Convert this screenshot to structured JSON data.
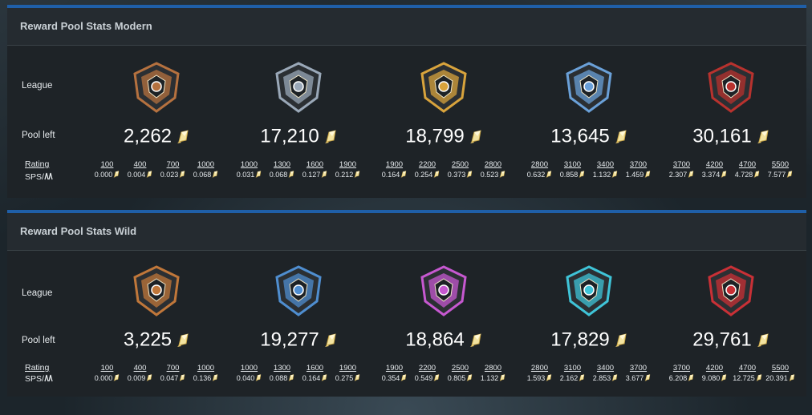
{
  "panels": [
    {
      "title": "Reward Pool Stats Modern",
      "labels": {
        "league": "League",
        "pool": "Pool left",
        "rating": "Rating",
        "sps": "SPS/"
      },
      "tiers": [
        {
          "pool": "2,262",
          "badge": "bronze-league-icon",
          "color": "#b5713f",
          "ratings": [
            "100",
            "400",
            "700",
            "1000"
          ],
          "sps": [
            "0.000",
            "0.004",
            "0.023",
            "0.068"
          ]
        },
        {
          "pool": "17,210",
          "badge": "silver-league-icon",
          "color": "#9aa8b8",
          "ratings": [
            "1000",
            "1300",
            "1600",
            "1900"
          ],
          "sps": [
            "0.031",
            "0.068",
            "0.127",
            "0.212"
          ]
        },
        {
          "pool": "18,799",
          "badge": "gold-league-icon",
          "color": "#d8a33c",
          "ratings": [
            "1900",
            "2200",
            "2500",
            "2800"
          ],
          "sps": [
            "0.164",
            "0.254",
            "0.373",
            "0.523"
          ]
        },
        {
          "pool": "13,645",
          "badge": "diamond-league-icon",
          "color": "#6aa0d8",
          "ratings": [
            "2800",
            "3100",
            "3400",
            "3700"
          ],
          "sps": [
            "0.632",
            "0.858",
            "1.132",
            "1.459"
          ]
        },
        {
          "pool": "30,161",
          "badge": "champion-league-icon",
          "color": "#b8322e",
          "ratings": [
            "3700",
            "4200",
            "4700",
            "5500"
          ],
          "sps": [
            "2.307",
            "3.374",
            "4.728",
            "7.577"
          ]
        }
      ]
    },
    {
      "title": "Reward Pool Stats Wild",
      "labels": {
        "league": "League",
        "pool": "Pool left",
        "rating": "Rating",
        "sps": "SPS/"
      },
      "tiers": [
        {
          "pool": "3,225",
          "badge": "bronze-league-icon",
          "color": "#c0773a",
          "ratings": [
            "100",
            "400",
            "700",
            "1000"
          ],
          "sps": [
            "0.000",
            "0.009",
            "0.047",
            "0.136"
          ]
        },
        {
          "pool": "19,277",
          "badge": "silver-league-icon",
          "color": "#4f8ed0",
          "ratings": [
            "1000",
            "1300",
            "1600",
            "1900"
          ],
          "sps": [
            "0.040",
            "0.088",
            "0.164",
            "0.275"
          ]
        },
        {
          "pool": "18,864",
          "badge": "gold-league-icon",
          "color": "#c658d0",
          "ratings": [
            "1900",
            "2200",
            "2500",
            "2800"
          ],
          "sps": [
            "0.354",
            "0.549",
            "0.805",
            "1.132"
          ]
        },
        {
          "pool": "17,829",
          "badge": "diamond-league-icon",
          "color": "#3fc4d8",
          "ratings": [
            "2800",
            "3100",
            "3400",
            "3700"
          ],
          "sps": [
            "1.593",
            "2.162",
            "2.853",
            "3.677"
          ]
        },
        {
          "pool": "29,761",
          "badge": "champion-league-icon",
          "color": "#c93036",
          "ratings": [
            "3700",
            "4200",
            "4700",
            "5500"
          ],
          "sps": [
            "6.208",
            "9.080",
            "12.725",
            "20.391"
          ]
        }
      ]
    }
  ]
}
